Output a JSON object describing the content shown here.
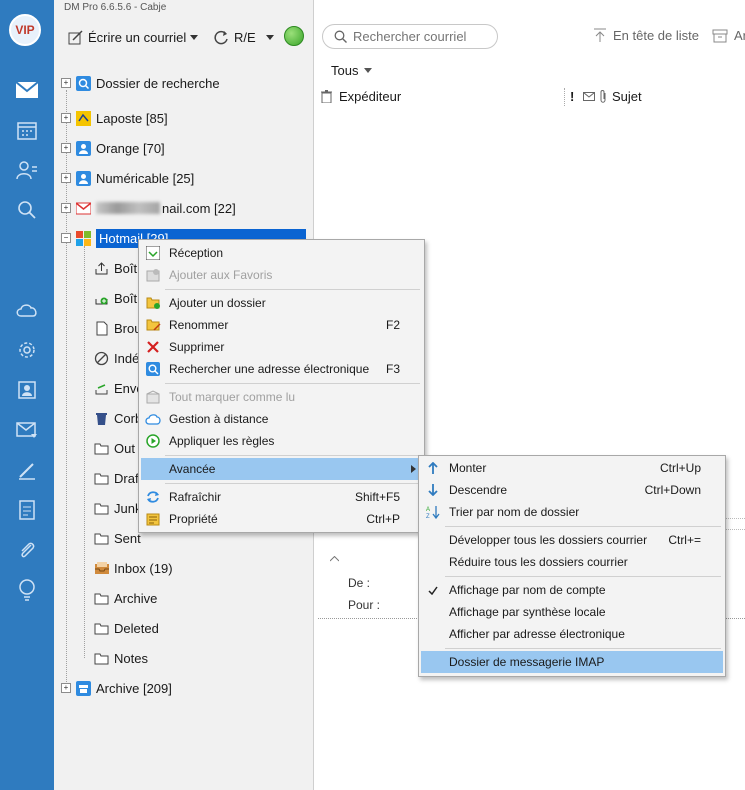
{
  "app": {
    "title": "DM Pro 6.6.5.6  -  Cabje"
  },
  "toolbar": {
    "compose_label": "Écrire un courriel",
    "reply_label": "R/E"
  },
  "search": {
    "placeholder": "Rechercher courriel"
  },
  "list_header": {
    "header_label": "En tête de liste",
    "archive_label": "Ar",
    "filter_label": "Tous"
  },
  "columns": {
    "sender": "Expéditeur",
    "flag": "!",
    "subject": "Sujet"
  },
  "preview": {
    "from_label": "De :",
    "to_label": "Pour :"
  },
  "folders": {
    "search_folder": "Dossier de recherche",
    "accounts": [
      "Laposte [85]",
      "Orange [70]",
      "Numéricable [25]",
      "nail.com [22]",
      "Hotmail [29]",
      "Archive [209]"
    ],
    "hotmail_children": [
      "Boît",
      "Boît",
      "Brou",
      "Indé",
      "Envo",
      "Corb",
      "Out",
      "Draf",
      "Junk",
      "Sent",
      "Inbox (19)",
      "Archive",
      "Deleted",
      "Notes"
    ]
  },
  "context_menu": {
    "items": [
      {
        "label": "Réception",
        "shortcut": ""
      },
      {
        "label": "Ajouter aux Favoris",
        "shortcut": ""
      },
      {
        "label": "Ajouter un dossier",
        "shortcut": ""
      },
      {
        "label": "Renommer",
        "shortcut": "F2"
      },
      {
        "label": "Supprimer",
        "shortcut": ""
      },
      {
        "label": "Rechercher une adresse électronique",
        "shortcut": "F3"
      },
      {
        "label": "Tout marquer comme lu",
        "shortcut": ""
      },
      {
        "label": "Gestion à distance",
        "shortcut": ""
      },
      {
        "label": "Appliquer les règles",
        "shortcut": ""
      },
      {
        "label": "Avancée",
        "shortcut": ""
      },
      {
        "label": "Rafraîchir",
        "shortcut": "Shift+F5"
      },
      {
        "label": "Propriété",
        "shortcut": "Ctrl+P"
      }
    ]
  },
  "submenu": {
    "items": [
      {
        "label": "Monter",
        "shortcut": "Ctrl+Up"
      },
      {
        "label": "Descendre",
        "shortcut": "Ctrl+Down"
      },
      {
        "label": "Trier par nom de dossier",
        "shortcut": ""
      },
      {
        "label": "Développer tous les dossiers courrier",
        "shortcut": "Ctrl+="
      },
      {
        "label": "Réduire tous les dossiers courrier",
        "shortcut": ""
      },
      {
        "label": "Affichage par nom de compte",
        "shortcut": ""
      },
      {
        "label": "Affichage par synthèse locale",
        "shortcut": ""
      },
      {
        "label": "Afficher par adresse électronique",
        "shortcut": ""
      },
      {
        "label": "Dossier de messagerie IMAP",
        "shortcut": ""
      }
    ]
  },
  "colors": {
    "sidebar": "#2f7bbf",
    "selection": "#0a64d2",
    "menu_highlight": "#99c7f0"
  },
  "icons": {
    "nav": [
      "mail-icon",
      "calendar-icon",
      "contacts-icon",
      "search-icon",
      "cloud-icon",
      "settings-icon",
      "contact-card-icon",
      "mail-settings-icon",
      "pen-icon",
      "note-icon",
      "attachment-icon",
      "tips-icon"
    ]
  }
}
